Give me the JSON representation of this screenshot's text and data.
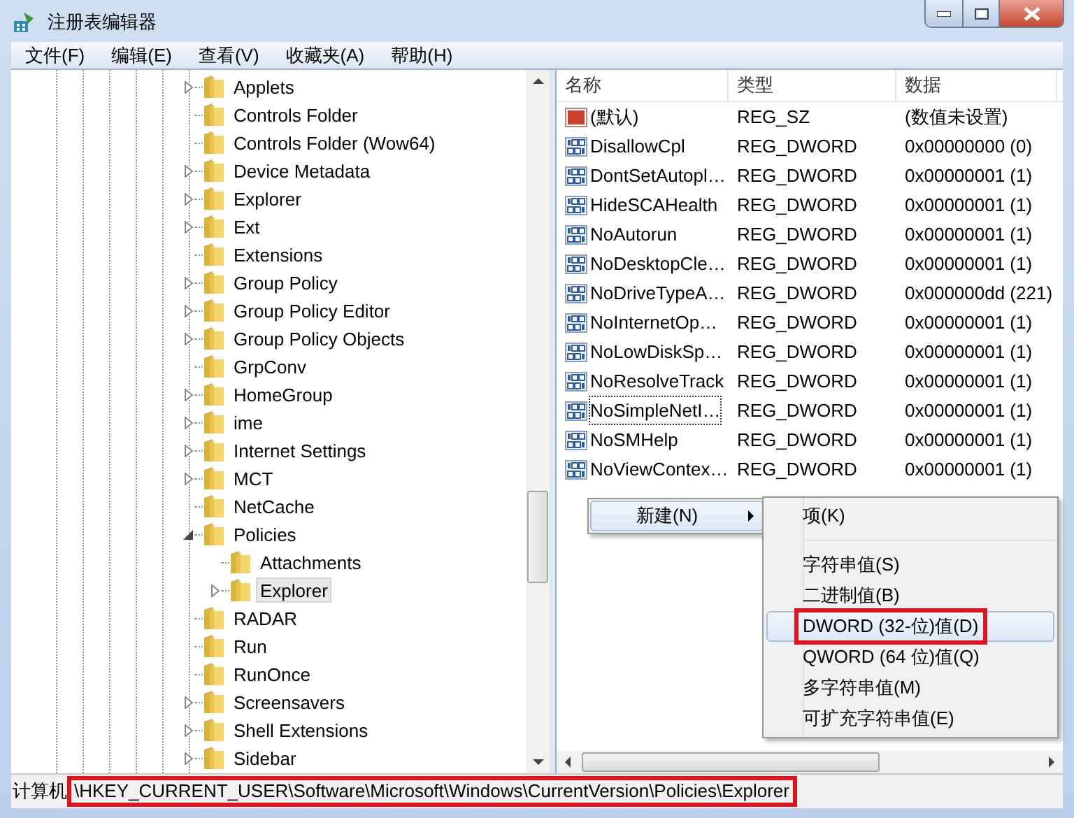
{
  "window": {
    "title": "注册表编辑器"
  },
  "menu": [
    "文件(F)",
    "编辑(E)",
    "查看(V)",
    "收藏夹(A)",
    "帮助(H)"
  ],
  "tree": [
    {
      "label": "Applets",
      "expandable": true,
      "expanded": false,
      "selected": false
    },
    {
      "label": "Controls Folder",
      "expandable": false,
      "selected": false
    },
    {
      "label": "Controls Folder (Wow64)",
      "expandable": false,
      "selected": false
    },
    {
      "label": "Device Metadata",
      "expandable": true,
      "expanded": false,
      "selected": false
    },
    {
      "label": "Explorer",
      "expandable": true,
      "expanded": false,
      "selected": false
    },
    {
      "label": "Ext",
      "expandable": true,
      "expanded": false,
      "selected": false
    },
    {
      "label": "Extensions",
      "expandable": false,
      "selected": false
    },
    {
      "label": "Group Policy",
      "expandable": true,
      "expanded": false,
      "selected": false
    },
    {
      "label": "Group Policy Editor",
      "expandable": true,
      "expanded": false,
      "selected": false
    },
    {
      "label": "Group Policy Objects",
      "expandable": true,
      "expanded": false,
      "selected": false
    },
    {
      "label": "GrpConv",
      "expandable": false,
      "selected": false
    },
    {
      "label": "HomeGroup",
      "expandable": true,
      "expanded": false,
      "selected": false
    },
    {
      "label": "ime",
      "expandable": true,
      "expanded": false,
      "selected": false
    },
    {
      "label": "Internet Settings",
      "expandable": true,
      "expanded": false,
      "selected": false
    },
    {
      "label": "MCT",
      "expandable": true,
      "expanded": false,
      "selected": false
    },
    {
      "label": "NetCache",
      "expandable": false,
      "selected": false
    },
    {
      "label": "Policies",
      "expandable": true,
      "expanded": true,
      "selected": false,
      "children": [
        {
          "label": "Attachments",
          "expandable": false,
          "selected": false
        },
        {
          "label": "Explorer",
          "expandable": true,
          "expanded": false,
          "selected": true
        }
      ]
    },
    {
      "label": "RADAR",
      "expandable": false,
      "selected": false
    },
    {
      "label": "Run",
      "expandable": false,
      "selected": false
    },
    {
      "label": "RunOnce",
      "expandable": false,
      "selected": false
    },
    {
      "label": "Screensavers",
      "expandable": true,
      "expanded": false,
      "selected": false
    },
    {
      "label": "Shell Extensions",
      "expandable": true,
      "expanded": false,
      "selected": false
    },
    {
      "label": "Sidebar",
      "expandable": true,
      "expanded": false,
      "selected": false
    }
  ],
  "table": {
    "columns": [
      "名称",
      "类型",
      "数据"
    ],
    "rows": [
      {
        "kind": "string",
        "name": "(默认)",
        "type": "REG_SZ",
        "data": "(数值未设置)",
        "focused": false
      },
      {
        "kind": "dword",
        "name": "DisallowCpl",
        "type": "REG_DWORD",
        "data": "0x00000000 (0)",
        "focused": false
      },
      {
        "kind": "dword",
        "name": "DontSetAutopl…",
        "type": "REG_DWORD",
        "data": "0x00000001 (1)",
        "focused": false
      },
      {
        "kind": "dword",
        "name": "HideSCAHealth",
        "type": "REG_DWORD",
        "data": "0x00000001 (1)",
        "focused": false
      },
      {
        "kind": "dword",
        "name": "NoAutorun",
        "type": "REG_DWORD",
        "data": "0x00000001 (1)",
        "focused": false
      },
      {
        "kind": "dword",
        "name": "NoDesktopCle…",
        "type": "REG_DWORD",
        "data": "0x00000001 (1)",
        "focused": false
      },
      {
        "kind": "dword",
        "name": "NoDriveTypeA…",
        "type": "REG_DWORD",
        "data": "0x000000dd (221)",
        "focused": false
      },
      {
        "kind": "dword",
        "name": "NoInternetOp…",
        "type": "REG_DWORD",
        "data": "0x00000001 (1)",
        "focused": false
      },
      {
        "kind": "dword",
        "name": "NoLowDiskSp…",
        "type": "REG_DWORD",
        "data": "0x00000001 (1)",
        "focused": false
      },
      {
        "kind": "dword",
        "name": "NoResolveTrack",
        "type": "REG_DWORD",
        "data": "0x00000001 (1)",
        "focused": false
      },
      {
        "kind": "dword",
        "name": "NoSimpleNetI…",
        "type": "REG_DWORD",
        "data": "0x00000001 (1)",
        "focused": true
      },
      {
        "kind": "dword",
        "name": "NoSMHelp",
        "type": "REG_DWORD",
        "data": "0x00000001 (1)",
        "focused": false
      },
      {
        "kind": "dword",
        "name": "NoViewContex…",
        "type": "REG_DWORD",
        "data": "0x00000001 (1)",
        "focused": false
      }
    ]
  },
  "context_menu": {
    "items": [
      {
        "label": "新建(N)",
        "selected": true
      }
    ]
  },
  "submenu": {
    "items": [
      {
        "kind": "item",
        "label": "项(K)",
        "selected": false,
        "annotated": false
      },
      {
        "kind": "separator"
      },
      {
        "kind": "item",
        "label": "字符串值(S)",
        "selected": false,
        "annotated": false
      },
      {
        "kind": "item",
        "label": "二进制值(B)",
        "selected": false,
        "annotated": false
      },
      {
        "kind": "item",
        "label": "DWORD (32-位)值(D)",
        "selected": true,
        "annotated": true
      },
      {
        "kind": "item",
        "label": "QWORD (64 位)值(Q)",
        "selected": false,
        "annotated": false
      },
      {
        "kind": "item",
        "label": "多字符串值(M)",
        "selected": false,
        "annotated": false
      },
      {
        "kind": "item",
        "label": "可扩充字符串值(E)",
        "selected": false,
        "annotated": false
      }
    ]
  },
  "status_bar": {
    "root": "计算机",
    "path": "\\HKEY_CURRENT_USER\\Software\\Microsoft\\Windows\\CurrentVersion\\Policies\\Explorer",
    "annotated": true
  }
}
